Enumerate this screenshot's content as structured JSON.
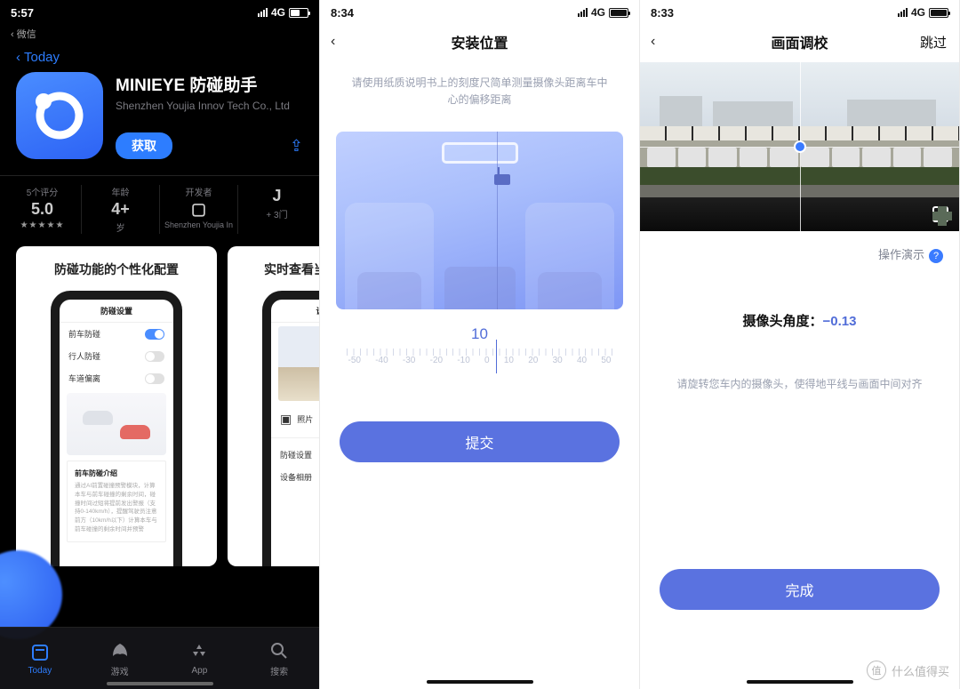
{
  "watermark": "什么值得买",
  "phone1": {
    "status": {
      "time": "5:57",
      "carrier_back": "微信",
      "net": "4G"
    },
    "today": "Today",
    "app": {
      "title": "MINIEYE 防碰助手",
      "subtitle": "Shenzhen Youjia Innov Tech Co., Ltd",
      "get": "获取"
    },
    "info": {
      "ratings_label": "5个评分",
      "rating": "5.0",
      "age_label": "年龄",
      "age": "4+",
      "age_unit": "岁",
      "dev_label": "开发者",
      "dev": "Shenzhen Youjia In",
      "more_label": "",
      "more": "J",
      "more_sub": "+ 3门"
    },
    "shots": {
      "s1_title": "防碰功能的个性化配置",
      "s1_head": "防碰设置",
      "s1_rows": [
        "前车防碰",
        "行人防碰",
        "车道偏离"
      ],
      "s1_card_title": "前车防碰介绍",
      "s1_card_body": "通过AI前置碰撞预警模块，计算本车与前车碰撞的剩余时间，碰撞时间过短将提前发出警报（支持0-140km/h），提醒驾驶员注意前方（10km/h以下）计算本车与前车碰撞的剩余时间并预警",
      "s2_title": "实时查看当前画面/回放",
      "s2_head": "设备 A",
      "s2_photo": "照片",
      "s2_menu": [
        "防碰设置",
        "设备相册"
      ]
    },
    "tabs": [
      "Today",
      "游戏",
      "App",
      "搜索"
    ]
  },
  "phone2": {
    "status": {
      "time": "8:34",
      "net": "4G"
    },
    "title": "安装位置",
    "intro": "请使用纸质说明书上的刻度尺简单测量摄像头距离车中心的偏移距离",
    "ruler_value": "10",
    "ticks": [
      "-50",
      "-40",
      "-30",
      "-20",
      "-10",
      "0",
      "10",
      "20",
      "30",
      "40",
      "50"
    ],
    "submit": "提交"
  },
  "phone3": {
    "status": {
      "time": "8:33",
      "net": "4G"
    },
    "title": "画面调校",
    "skip": "跳过",
    "demo": "操作演示",
    "angle_label": "摄像头角度：",
    "angle_value": "−0.13",
    "hint": "请旋转您车内的摄像头，使得地平线与画面中间对齐",
    "done": "完成"
  }
}
